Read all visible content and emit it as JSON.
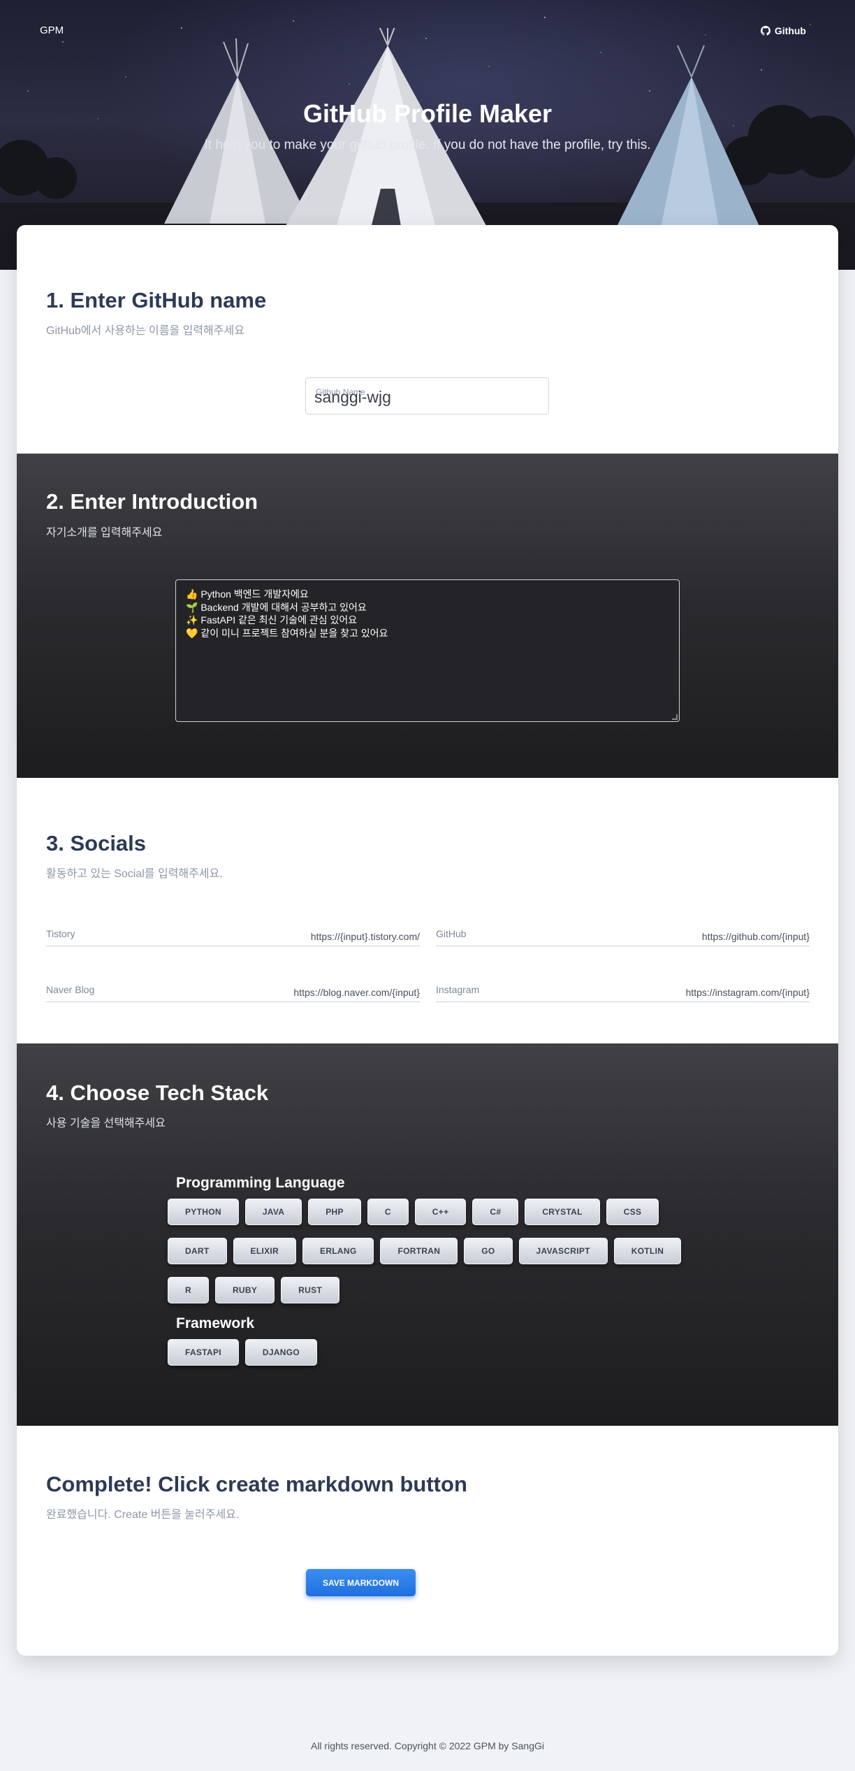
{
  "nav": {
    "brand": "GPM",
    "github_label": "Github"
  },
  "hero": {
    "title": "GitHub Profile Maker",
    "subtitle": "It help you to make your github profile. If you do not have the profile, try this."
  },
  "step1": {
    "title": "1. Enter GitHub name",
    "subtitle": "GitHub에서 사용하는 이름을 입력해주세요",
    "field_label": "Github Name",
    "field_value": "sanggi-wjg"
  },
  "step2": {
    "title": "2. Enter Introduction",
    "subtitle": "자기소개를 입력해주세요",
    "lines": [
      "👍 Python 백엔드 개발자에요",
      "🌱 Backend 개발에 대해서 공부하고 있어요",
      "✨ FastAPI 같은 최신 기술에 관심 있어요",
      "💛 같이 미니 프로젝트 참여하실 분을 찾고 있어요"
    ]
  },
  "step3": {
    "title": "3. Socials",
    "subtitle": "활동하고 있는 Social를 입력해주세요.",
    "fields": [
      {
        "label": "Tistory",
        "placeholder": "https://{input}.tistory.com/"
      },
      {
        "label": "GitHub",
        "placeholder": "https://github.com/{input}"
      },
      {
        "label": "Naver Blog",
        "placeholder": "https://blog.naver.com/{input}"
      },
      {
        "label": "Instagram",
        "placeholder": "https://instagram.com/{input}"
      }
    ]
  },
  "step4": {
    "title": "4. Choose Tech Stack",
    "subtitle": "사용 기술을 선택해주세요",
    "languages_title": "Programming Language",
    "languages": [
      "PYTHON",
      "JAVA",
      "PHP",
      "C",
      "C++",
      "C#",
      "CRYSTAL",
      "CSS",
      "DART",
      "ELIXIR",
      "ERLANG",
      "FORTRAN",
      "GO",
      "JAVASCRIPT",
      "KOTLIN",
      "R",
      "RUBY",
      "RUST"
    ],
    "frameworks_title": "Framework",
    "frameworks": [
      "FASTAPI",
      "DJANGO"
    ]
  },
  "step5": {
    "title": "Complete! Click create markdown button",
    "subtitle": "완료했습니다. Create 버튼을 눌러주세요.",
    "button_label": "SAVE MARKDOWN"
  },
  "footer": {
    "text": "All rights reserved. Copyright © 2022 GPM by SangGi"
  },
  "colors": {
    "primary_button": "#2b7de9",
    "heading": "#2d3a55",
    "dark_section": "#2b2b2f"
  }
}
